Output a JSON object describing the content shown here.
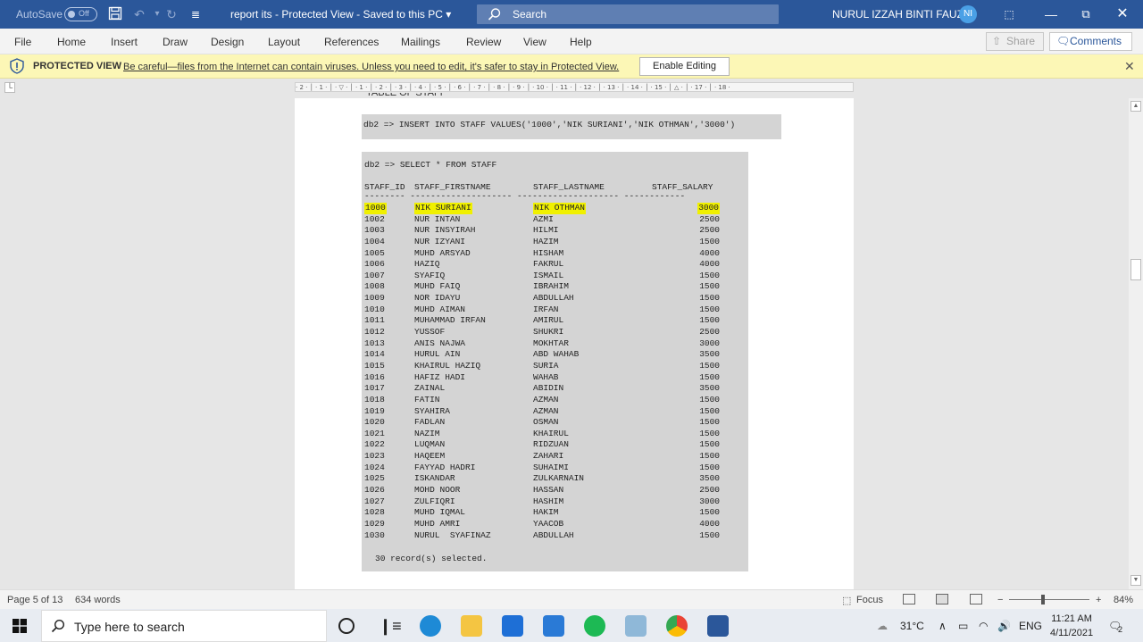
{
  "titlebar": {
    "autosave_label": "AutoSave",
    "autosave_state": "Off",
    "document_title": "report its  -  Protected View  -  Saved to this PC  ▾",
    "search_placeholder": "Search",
    "user_name": "NURUL IZZAH BINTI FAUZI",
    "user_initials": "NI"
  },
  "menu": {
    "items": [
      "File",
      "Home",
      "Insert",
      "Draw",
      "Design",
      "Layout",
      "References",
      "Mailings",
      "Review",
      "View",
      "Help"
    ],
    "share_label": "Share",
    "comments_label": "Comments"
  },
  "protected": {
    "title": "PROTECTED VIEW",
    "message": "Be careful—files from the Internet can contain viruses. Unless you need to edit, it's safer to stay in Protected View.",
    "enable_label": "Enable Editing"
  },
  "ruler": {
    "text": "· 2 · │ · 1 · │ · ▽ · │ · 1 · │ · 2 · │ · 3 · │ · 4 · │ · 5 · │ · 6 · │ · 7 · │ · 8 · │ · 9 · │ · 10 · │ · 11 · │ · 12 · │ · 13 · │ · 14 · │ · 15 · │ △ · │ · 17 · │ · 18 ·"
  },
  "document": {
    "partial_heading": "TABLE OF STAFF",
    "insert_command": "db2 => INSERT INTO STAFF VALUES('1000','NIK SURIANI','NIK OTHMAN','3000')",
    "select_command": "db2 => SELECT * FROM STAFF",
    "headers": [
      "STAFF_ID",
      "STAFF_FIRSTNAME",
      "STAFF_LASTNAME",
      "STAFF_SALARY"
    ],
    "separator": "-------- -------------------- -------------------- ------------",
    "rows": [
      [
        "1000",
        "NIK SURIANI",
        "NIK OTHMAN",
        "3000"
      ],
      [
        "1002",
        "NUR INTAN",
        "AZMI",
        "2500"
      ],
      [
        "1003",
        "NUR INSYIRAH",
        "HILMI",
        "2500"
      ],
      [
        "1004",
        "NUR IZYANI",
        "HAZIM",
        "1500"
      ],
      [
        "1005",
        "MUHD ARSYAD",
        "HISHAM",
        "4000"
      ],
      [
        "1006",
        "HAZIQ",
        "FAKRUL",
        "4000"
      ],
      [
        "1007",
        "SYAFIQ",
        "ISMAIL",
        "1500"
      ],
      [
        "1008",
        "MUHD FAIQ",
        "IBRAHIM",
        "1500"
      ],
      [
        "1009",
        "NOR IDAYU",
        "ABDULLAH",
        "1500"
      ],
      [
        "1010",
        "MUHD AIMAN",
        "IRFAN",
        "1500"
      ],
      [
        "1011",
        "MUHAMMAD IRFAN",
        "AMIRUL",
        "1500"
      ],
      [
        "1012",
        "YUSSOF",
        "SHUKRI",
        "2500"
      ],
      [
        "1013",
        "ANIS NAJWA",
        "MOKHTAR",
        "3000"
      ],
      [
        "1014",
        "HURUL AIN",
        "ABD WAHAB",
        "3500"
      ],
      [
        "1015",
        "KHAIRUL HAZIQ",
        "SURIA",
        "1500"
      ],
      [
        "1016",
        "HAFIZ HADI",
        "WAHAB",
        "1500"
      ],
      [
        "1017",
        "ZAINAL",
        "ABIDIN",
        "3500"
      ],
      [
        "1018",
        "FATIN",
        "AZMAN",
        "1500"
      ],
      [
        "1019",
        "SYAHIRA",
        "AZMAN",
        "1500"
      ],
      [
        "1020",
        "FADLAN",
        "OSMAN",
        "1500"
      ],
      [
        "1021",
        "NAZIM",
        "KHAIRUL",
        "1500"
      ],
      [
        "1022",
        "LUQMAN",
        "RIDZUAN",
        "1500"
      ],
      [
        "1023",
        "HAQEEM",
        "ZAHARI",
        "1500"
      ],
      [
        "1024",
        "FAYYAD HADRI",
        "SUHAIMI",
        "1500"
      ],
      [
        "1025",
        "ISKANDAR",
        "ZULKARNAIN",
        "3500"
      ],
      [
        "1026",
        "MOHD NOOR",
        "HASSAN",
        "2500"
      ],
      [
        "1027",
        "ZULFIQRI",
        "HASHIM",
        "3000"
      ],
      [
        "1028",
        "MUHD IQMAL",
        "HAKIM",
        "1500"
      ],
      [
        "1029",
        "MUHD AMRI",
        "YAACOB",
        "4000"
      ],
      [
        "1030",
        "NURUL  SYAFINAZ",
        "ABDULLAH",
        "1500"
      ]
    ],
    "highlighted_row": 0,
    "highlight_color": "#f0f000",
    "footer": "30 record(s) selected."
  },
  "status": {
    "page": "Page 5 of 13",
    "words": "634 words",
    "focus": "Focus",
    "zoom": "84%",
    "zoom_minus": "−",
    "zoom_plus": "+"
  },
  "taskbar": {
    "search_placeholder": "Type here to search",
    "temperature": "31°C",
    "language": "ENG",
    "time": "11:21 AM",
    "date": "4/11/2021",
    "notification_count": "2"
  },
  "colors": {
    "titlebar": "#2b579a",
    "protected_bar": "#fcf7b6",
    "code_background": "#d4d4d4"
  }
}
